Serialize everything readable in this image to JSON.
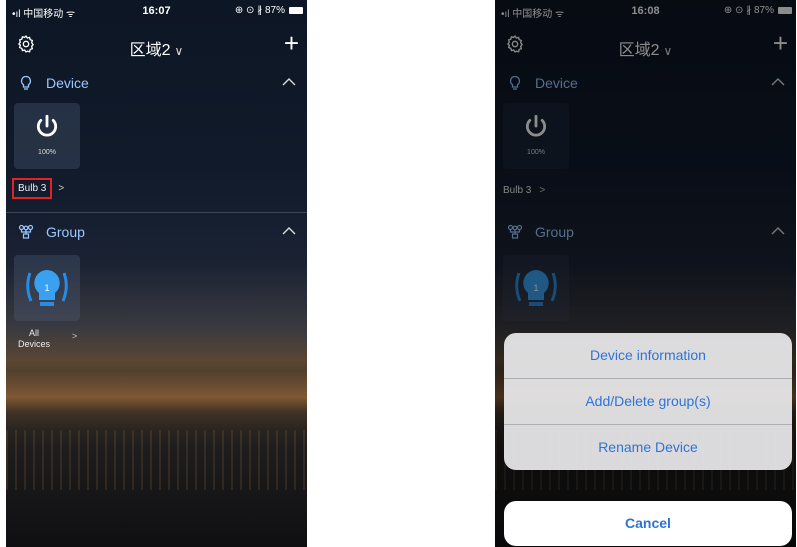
{
  "status_left": {
    "carrier": "•ıl 中国移动 ᯤ",
    "time": "16:07",
    "indicators": "⊕ ⊙ ∦ 87%"
  },
  "status_right": {
    "carrier": "•ıl 中国移动 ᯤ",
    "time": "16:08",
    "indicators": "⊕ ⊙ ∦ 87%"
  },
  "header": {
    "title": "区域2",
    "dropdown_glyph": "∨",
    "add_glyph": "+"
  },
  "sections": {
    "device": {
      "label": "Device",
      "icon": "bulb-outline-icon"
    },
    "group": {
      "label": "Group",
      "icon": "group-nodes-icon"
    }
  },
  "device_tile": {
    "percent": "100%",
    "name": "Bulb 3",
    "chevron": ">"
  },
  "group_tile": {
    "badge": "1",
    "name_line1": "All",
    "name_line2": "Devices",
    "chevron": ">"
  },
  "action_sheet": {
    "items": [
      "Device information",
      "Add/Delete group(s)",
      "Rename Device"
    ],
    "cancel": "Cancel"
  },
  "colors": {
    "accent": "#2f73d6",
    "highlight": "#e02424",
    "section_label": "#9cc7ff"
  }
}
